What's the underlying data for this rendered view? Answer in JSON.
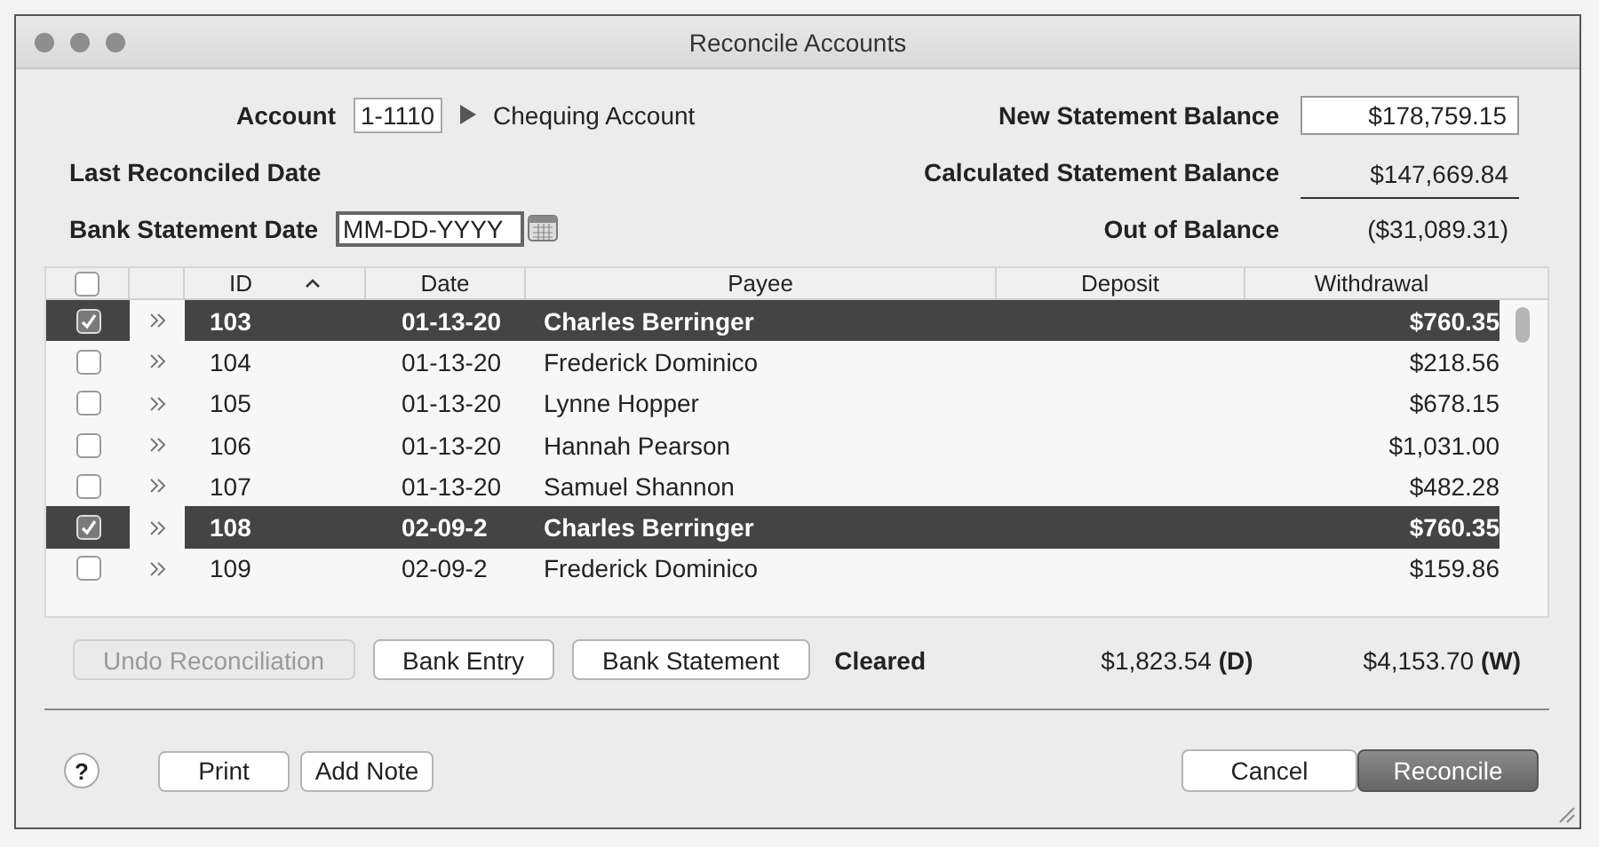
{
  "window": {
    "title": "Reconcile Accounts"
  },
  "account": {
    "label": "Account",
    "value": "1-1110",
    "name": "Chequing Account"
  },
  "last_reconciled_date": {
    "label": "Last Reconciled Date"
  },
  "bank_statement_date": {
    "label": "Bank Statement Date",
    "placeholder": "MM-DD-YYYY"
  },
  "balances": [
    {
      "kind": "field",
      "label": "New Statement Balance",
      "value": "$178,759.15"
    },
    {
      "kind": "underlined",
      "label": "Calculated Statement Balance",
      "value": "$147,669.84"
    },
    {
      "kind": "plain",
      "label": "Out of Balance",
      "value": "($31,089.31)"
    }
  ],
  "table": {
    "header_checked": false,
    "columns": [
      {
        "label": "ID",
        "sorted": true
      },
      {
        "label": "Date",
        "sorted": false
      },
      {
        "label": "Payee",
        "sorted": false
      },
      {
        "label": "Deposit",
        "sorted": false
      },
      {
        "label": "Withdrawal",
        "sorted": false
      }
    ],
    "rows": [
      {
        "checked": true,
        "selected": true,
        "id": "103",
        "date": "01-13-20",
        "payee": "Charles Berringer",
        "withdrawal": "$760.35"
      },
      {
        "checked": false,
        "selected": false,
        "id": "104",
        "date": "01-13-20",
        "payee": "Frederick Dominico",
        "withdrawal": "$218.56"
      },
      {
        "checked": false,
        "selected": false,
        "id": "105",
        "date": "01-13-20",
        "payee": "Lynne Hopper",
        "withdrawal": "$678.15"
      },
      {
        "checked": false,
        "selected": false,
        "id": "106",
        "date": "01-13-20",
        "payee": "Hannah Pearson",
        "withdrawal": "$1,031.00"
      },
      {
        "checked": false,
        "selected": false,
        "id": "107",
        "date": "01-13-20",
        "payee": "Samuel Shannon",
        "withdrawal": "$482.28"
      },
      {
        "checked": true,
        "selected": true,
        "id": "108",
        "date": "02-09-2",
        "payee": "Charles Berringer",
        "withdrawal": "$760.35"
      },
      {
        "checked": false,
        "selected": false,
        "id": "109",
        "date": "02-09-2",
        "payee": "Frederick Dominico",
        "withdrawal": "$159.86"
      }
    ]
  },
  "actions": [
    {
      "label": "Undo Reconciliation",
      "disabled": true
    },
    {
      "label": "Bank Entry",
      "disabled": false
    },
    {
      "label": "Bank Statement",
      "disabled": false
    }
  ],
  "cleared": {
    "label": "Cleared",
    "deposit": "$1,823.54 **(D)**",
    "withdrawal": "$4,153.70 **(W)**"
  },
  "footer": {
    "help": "?",
    "left_buttons": [
      "Print",
      "Add Note"
    ],
    "right_buttons": [
      {
        "label": "Cancel",
        "default": false
      },
      {
        "label": "Reconcile",
        "default": true
      }
    ]
  }
}
